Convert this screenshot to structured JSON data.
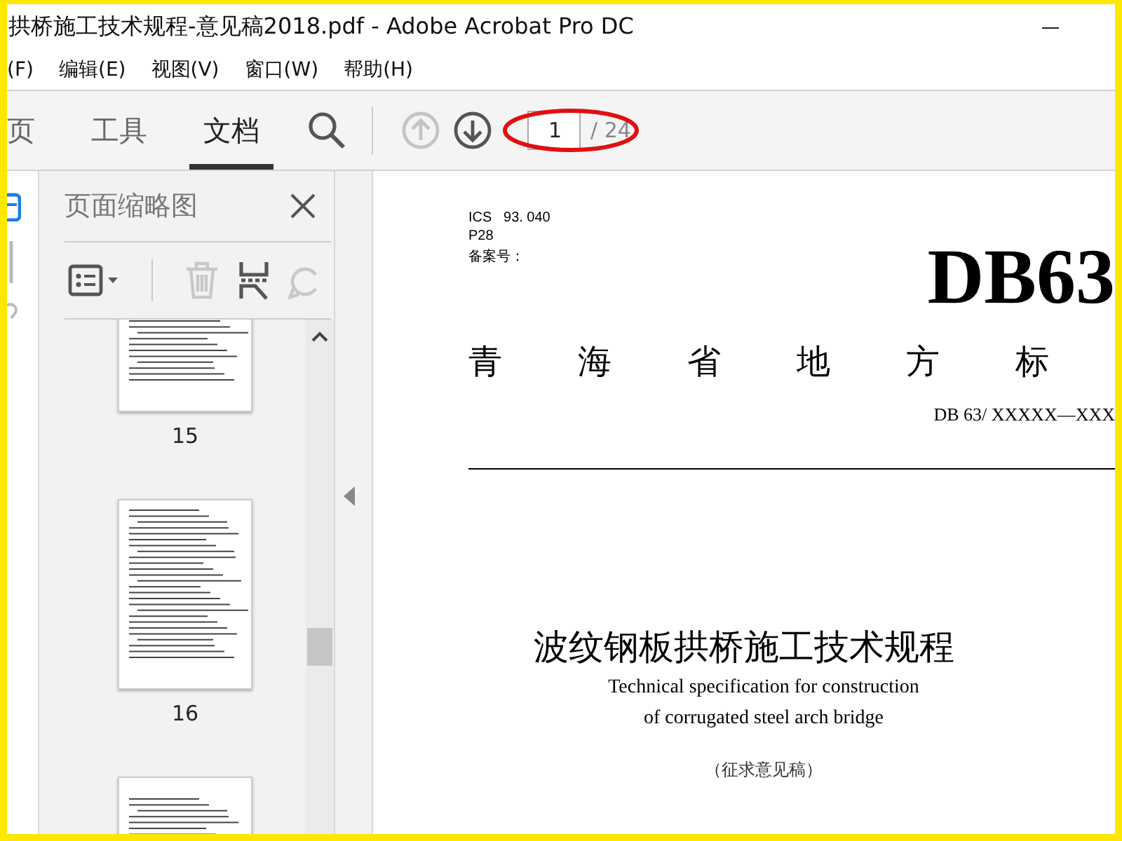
{
  "window": {
    "title": "拱桥施工技术规程-意见稿2018.pdf - Adobe Acrobat Pro DC"
  },
  "menu": [
    "(F)",
    "编辑(E)",
    "视图(V)",
    "窗口(W)",
    "帮助(H)"
  ],
  "tabs": [
    {
      "label": "页",
      "selected": false
    },
    {
      "label": "工具",
      "selected": false
    },
    {
      "label": "文档",
      "selected": true
    }
  ],
  "page_nav": {
    "previous_disabled": true,
    "current_page": "1",
    "total": "/ 24"
  },
  "thumbnails_panel": {
    "title": "页面缩略图",
    "delete_disabled": true,
    "rotate_disabled": true,
    "thumbnails": [
      {
        "label": "15"
      },
      {
        "label": "16"
      }
    ],
    "partial_thumbnail": true
  },
  "document": {
    "ics": "ICS   93. 040",
    "classification": "P28",
    "record_no": "备案号：",
    "code_mark": "DB63",
    "issuer_chars": [
      "青",
      "海",
      "省",
      "地",
      "方",
      "标"
    ],
    "standard_no": "DB 63/  XXXXX—XXX",
    "title": "波纹钢板拱桥施工技术规程",
    "english_title": [
      "Technical specification for construction",
      "of corrugated steel arch bridge"
    ],
    "status": "（征求意见稿）"
  }
}
